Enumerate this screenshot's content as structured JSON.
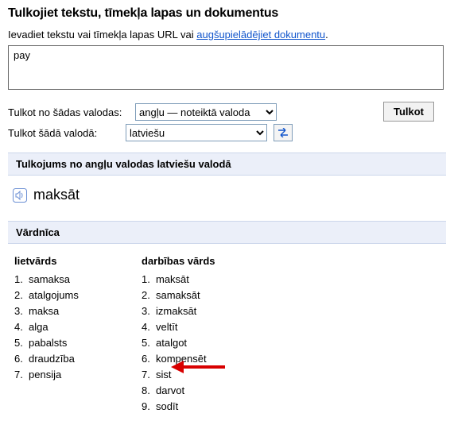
{
  "title": "Tulkojiet tekstu, tīmekļa lapas un dokumentus",
  "instructions": {
    "prefix": "Ievadiet tekstu vai tīmekļa lapas URL vai ",
    "link": "augšupielādējiet dokumentu",
    "suffix": "."
  },
  "input_value": "pay",
  "from_label": "Tulkot no šādas valodas:",
  "from_value": "angļu — noteiktā valoda",
  "to_label": "Tulkot šādā valodā:",
  "to_value": "latviešu",
  "translate_btn": "Tulkot",
  "result_header": "Tulkojums no angļu valodas latviešu valodā",
  "result_text": "maksāt",
  "dict_header": "Vārdnīca",
  "dict": [
    {
      "pos": "lietvārds",
      "items": [
        "samaksa",
        "atalgojums",
        "maksa",
        "alga",
        "pabalsts",
        "draudzība",
        "pensija"
      ]
    },
    {
      "pos": "darbības vārds",
      "items": [
        "maksāt",
        "samaksāt",
        "izmaksāt",
        "veltīt",
        "atalgot",
        "kompensēt",
        "sist",
        "darvot",
        "sodīt"
      ]
    }
  ]
}
